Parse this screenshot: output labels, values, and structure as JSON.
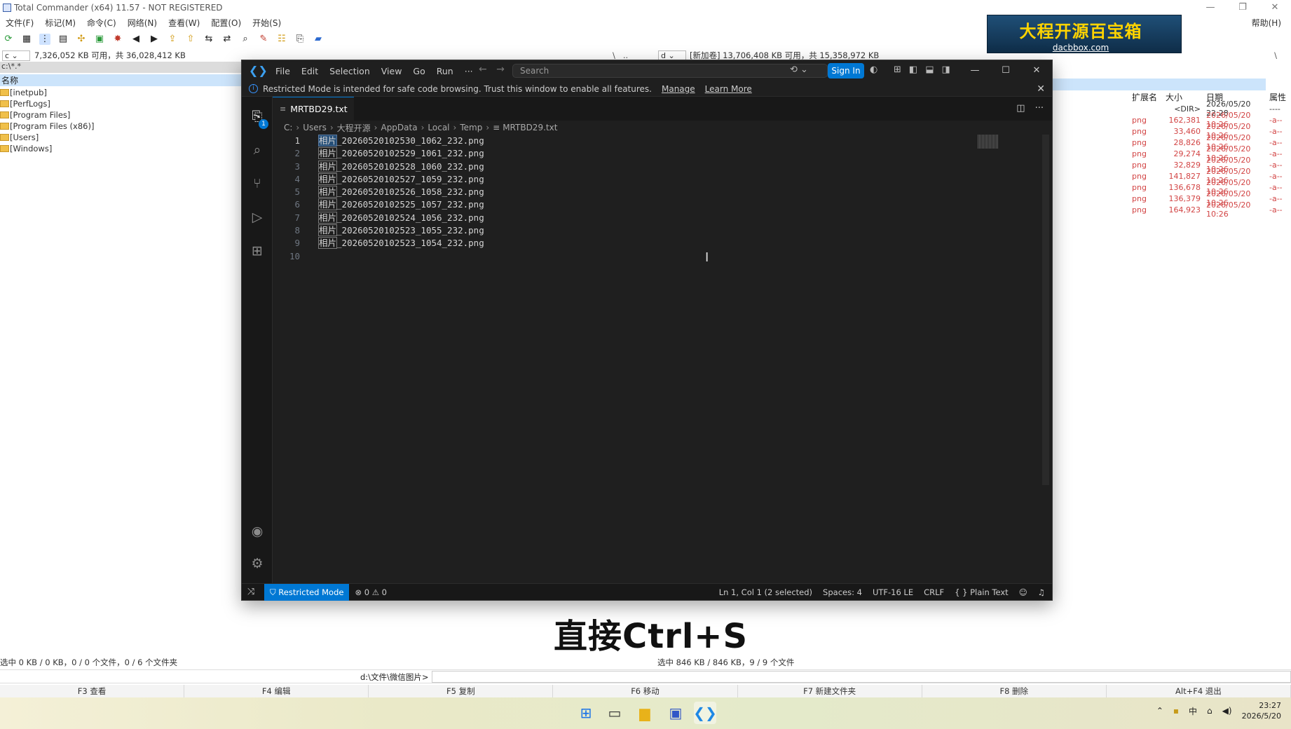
{
  "tc": {
    "title": "Total Commander (x64) 11.57 - NOT REGISTERED",
    "menu": [
      "文件(F)",
      "标记(M)",
      "命令(C)",
      "网络(N)",
      "查看(W)",
      "配置(O)",
      "开始(S)"
    ],
    "help": "帮助(H)",
    "left_drive": "c",
    "left_drive_info": "7,326,052 KB 可用，共 36,028,412 KB",
    "right_drive": "d",
    "right_drive_info": "[新加卷]  13,706,408 KB 可用，共 15,358,972 KB",
    "left_path": "c:\\*.*",
    "left_name_header": "名称",
    "left_items": [
      "[inetpub]",
      "[PerfLogs]",
      "[Program Files]",
      "[Program Files (x86)]",
      "[Users]",
      "[Windows]"
    ],
    "right_headers": {
      "ext": "扩展名",
      "size": "大小",
      "date": "日期",
      "attr": "属性"
    },
    "right_rows": [
      {
        "ext": "",
        "size": "<DIR>",
        "date": "2026/05/20 22:28",
        "attr": "----"
      },
      {
        "ext": "png",
        "size": "162,381",
        "date": "2026/05/20 10:26",
        "attr": "-a--"
      },
      {
        "ext": "png",
        "size": "33,460",
        "date": "2026/05/20 10:26",
        "attr": "-a--"
      },
      {
        "ext": "png",
        "size": "28,826",
        "date": "2026/05/20 10:26",
        "attr": "-a--"
      },
      {
        "ext": "png",
        "size": "29,274",
        "date": "2026/05/20 10:26",
        "attr": "-a--"
      },
      {
        "ext": "png",
        "size": "32,829",
        "date": "2026/05/20 10:26",
        "attr": "-a--"
      },
      {
        "ext": "png",
        "size": "141,827",
        "date": "2026/05/20 10:26",
        "attr": "-a--"
      },
      {
        "ext": "png",
        "size": "136,678",
        "date": "2026/05/20 10:26",
        "attr": "-a--"
      },
      {
        "ext": "png",
        "size": "136,379",
        "date": "2026/05/20 10:26",
        "attr": "-a--"
      },
      {
        "ext": "png",
        "size": "164,923",
        "date": "2026/05/20 10:26",
        "attr": "-a--"
      }
    ],
    "left_status": "选中 0 KB / 0 KB，0 / 0 个文件，0 / 6 个文件夹",
    "right_status": "选中 846 KB / 846 KB，9 / 9 个文件",
    "cmd_path": "d:\\文件\\微信图片>",
    "fkeys": [
      "F3 查看",
      "F4 编辑",
      "F5 复制",
      "F6 移动",
      "F7 新建文件夹",
      "F8 删除",
      "Alt+F4 退出"
    ],
    "ad_text": "大程开源百宝箱",
    "ad_url": "dacbbox.com"
  },
  "vscode": {
    "menu": [
      "File",
      "Edit",
      "Selection",
      "View",
      "Go",
      "Run",
      "···"
    ],
    "search_placeholder": "Search",
    "sign_in": "Sign In",
    "banner_text": "Restricted Mode is intended for safe code browsing. Trust this window to enable all features.",
    "banner_manage": "Manage",
    "banner_learn": "Learn More",
    "tab_name": "MRTBD29.txt",
    "explorer_badge": "1",
    "breadcrumb": [
      "C:",
      "Users",
      "大程开源",
      "AppData",
      "Local",
      "Temp",
      "MRTBD29.txt"
    ],
    "lines": [
      {
        "prefix": "相片",
        "rest": "_20260520102530_1062_232.png"
      },
      {
        "prefix": "相片",
        "rest": "_20260520102529_1061_232.png"
      },
      {
        "prefix": "相片",
        "rest": "_20260520102528_1060_232.png"
      },
      {
        "prefix": "相片",
        "rest": "_20260520102527_1059_232.png"
      },
      {
        "prefix": "相片",
        "rest": "_20260520102526_1058_232.png"
      },
      {
        "prefix": "相片",
        "rest": "_20260520102525_1057_232.png"
      },
      {
        "prefix": "相片",
        "rest": "_20260520102524_1056_232.png"
      },
      {
        "prefix": "相片",
        "rest": "_20260520102523_1055_232.png"
      },
      {
        "prefix": "相片",
        "rest": "_20260520102523_1054_232.png"
      },
      {
        "prefix": "",
        "rest": ""
      }
    ],
    "line_numbers": [
      "1",
      "2",
      "3",
      "4",
      "5",
      "6",
      "7",
      "8",
      "9",
      "10"
    ],
    "status": {
      "restricted": "Restricted Mode",
      "problems": "⊗ 0 ⚠ 0",
      "position": "Ln 1, Col 1 (2 selected)",
      "spaces": "Spaces: 4",
      "encoding": "UTF-16 LE",
      "eol": "CRLF",
      "language": "{ }  Plain Text"
    }
  },
  "caption": "直接Ctrl+S",
  "clock": {
    "time": "23:27",
    "date": "2026/5/20"
  },
  "tray_ime": "中"
}
